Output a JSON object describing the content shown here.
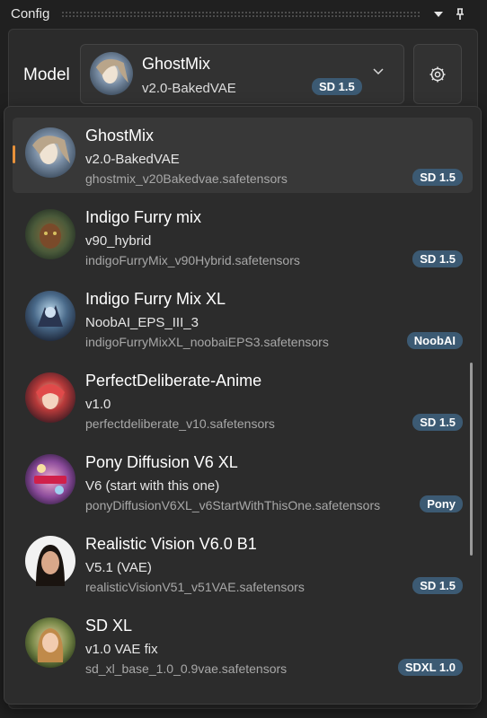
{
  "panel": {
    "title": "Config",
    "model_label": "Model"
  },
  "selected": {
    "name": "GhostMix",
    "version": "v2.0-BakedVAE",
    "badge": "SD 1.5"
  },
  "models": [
    {
      "name": "GhostMix",
      "version": "v2.0-BakedVAE",
      "file": "ghostmix_v20Bakedvae.safetensors",
      "badge": "SD 1.5"
    },
    {
      "name": "Indigo Furry mix",
      "version": "v90_hybrid",
      "file": "indigoFurryMix_v90Hybrid.safetensors",
      "badge": "SD 1.5"
    },
    {
      "name": "Indigo Furry Mix XL",
      "version": "NoobAI_EPS_III_3",
      "file": "indigoFurryMixXL_noobaiEPS3.safetensors",
      "badge": "NoobAI"
    },
    {
      "name": "PerfectDeliberate-Anime",
      "version": "v1.0",
      "file": "perfectdeliberate_v10.safetensors",
      "badge": "SD 1.5"
    },
    {
      "name": "Pony Diffusion V6 XL",
      "version": "V6 (start with this one)",
      "file": "ponyDiffusionV6XL_v6StartWithThisOne.safetensors",
      "badge": "Pony"
    },
    {
      "name": "Realistic Vision V6.0 B1",
      "version": "V5.1 (VAE)",
      "file": "realisticVisionV51_v51VAE.safetensors",
      "badge": "SD 1.5"
    },
    {
      "name": "SD XL",
      "version": "v1.0 VAE fix",
      "file": "sd_xl_base_1.0_0.9vae.safetensors",
      "badge": "SDXL 1.0"
    }
  ],
  "colors": {
    "accent": "#e8913a",
    "badge_bg": "#3c5a73"
  },
  "icons": {
    "dropdown": "chevron-down-icon",
    "pin": "pin-icon",
    "settings": "gear-icon"
  }
}
